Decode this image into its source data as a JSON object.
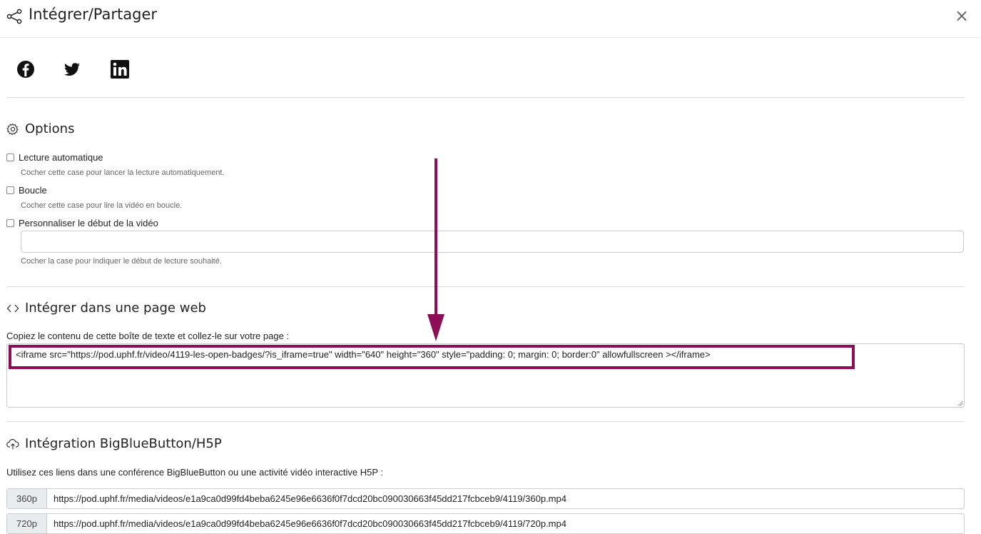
{
  "header": {
    "title": "Intégrer/Partager",
    "close_glyph": "×"
  },
  "social": [
    "facebook-icon",
    "twitter-icon",
    "linkedin-icon"
  ],
  "options": {
    "title": "Options",
    "autoplay": {
      "label": "Lecture automatique",
      "help": "Cocher cette case pour lancer la lecture automatiquement."
    },
    "loop": {
      "label": "Boucle",
      "help": "Cocher cette case pour lire la vidéo en boucle."
    },
    "start": {
      "label": "Personnaliser le début de la vidéo",
      "value": "",
      "help": "Cocher la case pour indiquer le début de lecture souhaité."
    }
  },
  "embed": {
    "title": "Intégrer dans une page web",
    "instructions": "Copiez le contenu de cette boîte de texte et collez-le sur votre page :",
    "code": "<iframe src=\"https://pod.uphf.fr/video/4119-les-open-badges/?is_iframe=true\" width=\"640\" height=\"360\" style=\"padding: 0; margin: 0; border:0\" allowfullscreen ></iframe>"
  },
  "bbb": {
    "title": "Intégration BigBlueButton/H5P",
    "instructions": "Utilisez ces liens dans une conférence BigBlueButton ou une activité vidéo interactive H5P :",
    "links": [
      {
        "label": "360p",
        "url": "https://pod.uphf.fr/media/videos/e1a9ca0d99fd4beba6245e96e6636f0f7dcd20bc090030663f45dd217fcbceb9/4119/360p.mp4"
      },
      {
        "label": "720p",
        "url": "https://pod.uphf.fr/media/videos/e1a9ca0d99fd4beba6245e96e6636f0f7dcd20bc090030663f45dd217fcbceb9/4119/720p.mp4"
      }
    ]
  },
  "colors": {
    "highlight": "#8b0e57",
    "text": "#222222",
    "muted": "#666666",
    "border": "#cccccc"
  }
}
